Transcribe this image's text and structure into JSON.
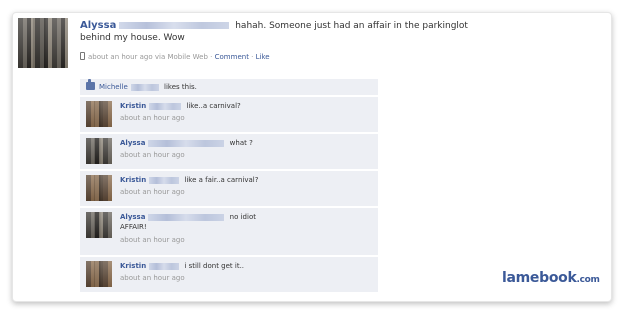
{
  "post": {
    "author": "Alyssa",
    "text": "hahah. Someone just had an affair in the parkinglot behind my house. Wow",
    "time": "about an hour ago via Mobile Web",
    "sep": "·",
    "comment_link": "Comment",
    "like_link": "Like"
  },
  "likes": {
    "name": "Michelle",
    "text": "likes this."
  },
  "comments": [
    {
      "author": "Kristin",
      "text": "like..a carnival?",
      "time": "about an hour ago"
    },
    {
      "author": "Alyssa",
      "text": "what ?",
      "time": "about an hour ago"
    },
    {
      "author": "Kristin",
      "text": "like a fair..a carnival?",
      "time": "about an hour ago"
    },
    {
      "author": "Alyssa",
      "text": "no idiot",
      "text2": "AFFAIR!",
      "time": "about an hour ago"
    },
    {
      "author": "Kristin",
      "text": "i still dont get it..",
      "time": "about an hour ago"
    }
  ],
  "brand": {
    "name": "lamebook",
    "tld": ".com"
  },
  "colors": {
    "link": "#3b5998",
    "comment_bg": "#edeff4",
    "meta": "#999999"
  },
  "icons": {
    "mobile": "mobile-phone-icon",
    "like": "thumbs-up-icon"
  }
}
